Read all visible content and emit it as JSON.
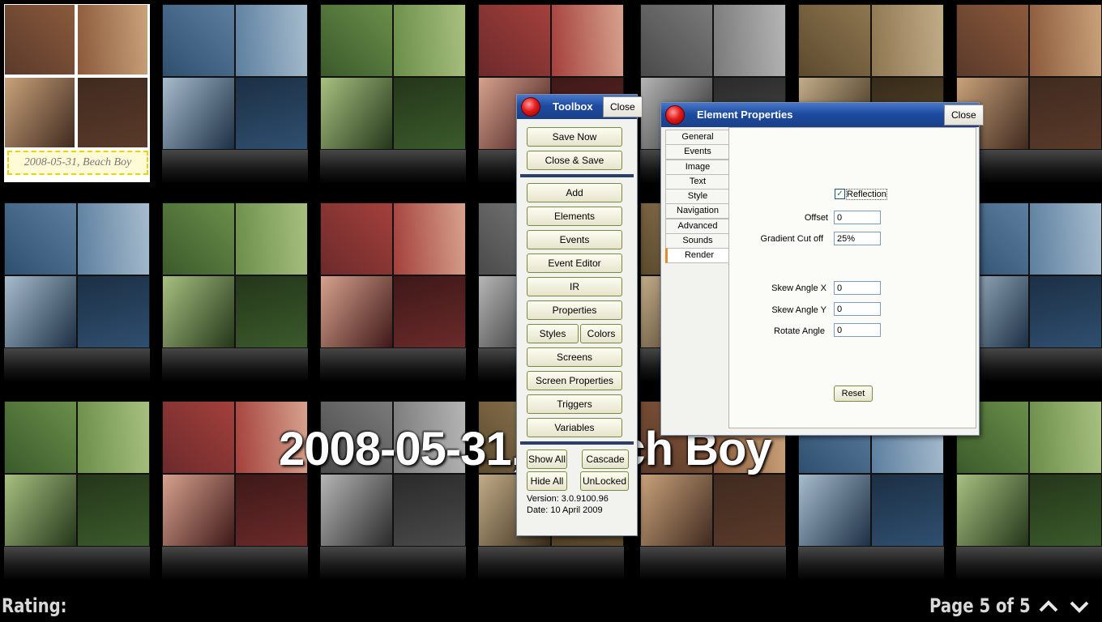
{
  "album": {
    "selected_caption": "2008-05-31, Beach Boy",
    "big_caption": "2008-05-31, Beach Boy"
  },
  "footer": {
    "rating_label": "Rating:",
    "page_label": "Page 5 of  5",
    "up_icon": "chevron-up-icon",
    "down_icon": "chevron-down-icon"
  },
  "toolbox": {
    "title": "Toolbox",
    "close_label": "Close",
    "buttons": {
      "save_now": "Save Now",
      "close_save": "Close & Save",
      "add": "Add",
      "elements": "Elements",
      "events": "Events",
      "event_editor": "Event Editor",
      "ir": "IR",
      "properties": "Properties",
      "styles": "Styles",
      "colors": "Colors",
      "screens": "Screens",
      "screen_properties": "Screen Properties",
      "triggers": "Triggers",
      "variables": "Variables",
      "show_all": "Show All",
      "cascade": "Cascade",
      "hide_all": "Hide All",
      "unlocked": "UnLocked"
    },
    "version": "Version: 3.0.9100.96",
    "date": "Date: 10 April 2009"
  },
  "element_properties": {
    "title": "Element Properties",
    "close_label": "Close",
    "tabs": [
      "General",
      "Events",
      "Image",
      "Text",
      "Style",
      "Navigation",
      "Advanced",
      "Sounds",
      "Render"
    ],
    "active_tab": "Render",
    "reflection_label": "Reflection",
    "reflection_checked": true,
    "offset_label": "Offset",
    "offset_value": "0",
    "gradient_label": "Gradient Cut off",
    "gradient_value": "25%",
    "skew_x_label": "Skew Angle X",
    "skew_x_value": "0",
    "skew_y_label": "Skew Angle Y",
    "skew_y_value": "0",
    "rotate_label": "Rotate Angle",
    "rotate_value": "0",
    "reset_label": "Reset"
  },
  "colors": {
    "title_bar": "#1d4ba0",
    "button_border": "#7a8b3e",
    "active_tab_accent": "#e18a2f"
  }
}
